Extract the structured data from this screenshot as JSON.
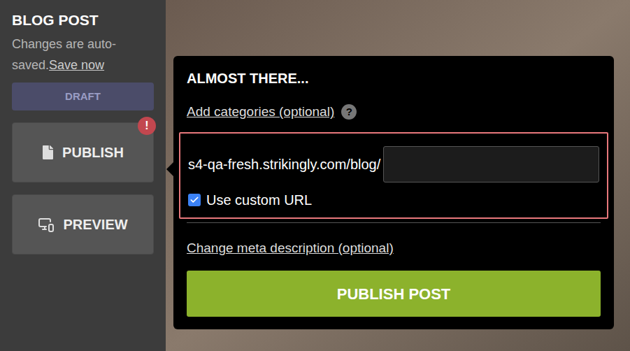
{
  "sidebar": {
    "title": "BLOG POST",
    "autosave_text": "Changes are auto-saved.",
    "save_link": "Save now",
    "status_badge": "DRAFT",
    "buttons": [
      {
        "label": "PUBLISH",
        "kind": "publish",
        "alert": "!"
      },
      {
        "label": "PREVIEW",
        "kind": "preview",
        "alert": ""
      }
    ]
  },
  "popup": {
    "title": "ALMOST THERE...",
    "categories_link": "Add categories (optional)",
    "help": "?",
    "url_prefix": "s4-qa-fresh.strikingly.com/blog/",
    "url_value": "",
    "custom_url": {
      "label": "Use custom URL",
      "checked": true
    },
    "meta_link": "Change meta description (optional)",
    "submit": "PUBLISH POST"
  }
}
